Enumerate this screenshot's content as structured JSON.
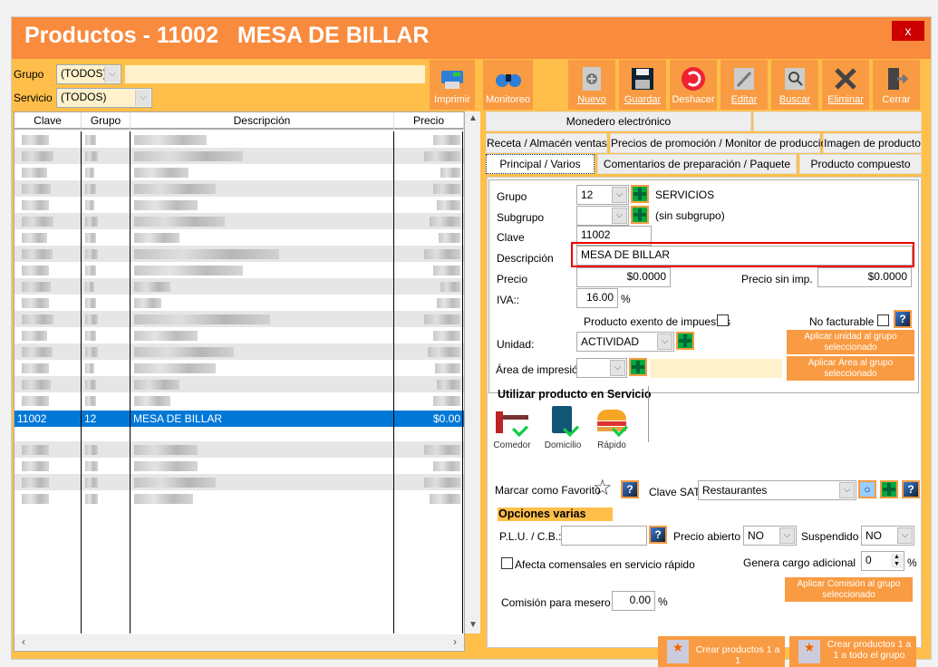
{
  "window": {
    "title": "Productos - 11002   MESA DE BILLAR",
    "close_label": "x"
  },
  "filters": {
    "grupo_label": "Grupo",
    "grupo_value": "(TODOS)",
    "servicio_label": "Servicio",
    "servicio_value": "(TODOS)",
    "search_value": ""
  },
  "toolbar": {
    "imprimir": "Imprimir",
    "monitoreo": "Monitoreo",
    "nuevo": "Nuevo",
    "guardar": "Guardar",
    "deshacer": "Deshacer",
    "editar": "Editar",
    "buscar": "Buscar",
    "eliminar": "Eliminar",
    "cerrar": "Cerrar"
  },
  "grid": {
    "columns": [
      "Clave",
      "Grupo",
      "Descripción",
      "Precio"
    ],
    "selected_row": {
      "clave": "11002",
      "grupo": "12",
      "descripcion": "MESA DE BILLAR",
      "precio": "$0.00"
    }
  },
  "tabs": {
    "row1": [
      "Monedero electrónico",
      ""
    ],
    "row2": [
      "Receta / Almacén ventas",
      "Precios de promoción / Monitor de producción",
      "Imagen de producto"
    ],
    "row3": [
      "Principal / Varios",
      "Comentarios de preparación / Paquete",
      "Producto compuesto"
    ],
    "active": "Principal / Varios"
  },
  "form": {
    "grupo_label": "Grupo",
    "grupo_value": "12",
    "grupo_name": "SERVICIOS",
    "subgrupo_label": "Subgrupo",
    "subgrupo_value": "",
    "subgrupo_name": "(sin subgrupo)",
    "clave_label": "Clave",
    "clave_value": "11002",
    "descripcion_label": "Descripción",
    "descripcion_value": "MESA DE BILLAR",
    "precio_label": "Precio",
    "precio_value": "$0.0000",
    "precio_sin_imp_label": "Precio sin imp.",
    "precio_sin_imp_value": "$0.0000",
    "iva_label": "IVA::",
    "iva_value": "16.00",
    "pct": "%",
    "exento_label": "Producto exento de impuestos",
    "exento_checked": false,
    "no_facturable_label": "No facturable",
    "no_facturable_checked": false,
    "unidad_label": "Unidad:",
    "unidad_value": "ACTIVIDAD",
    "aplicar_unidad": "Aplicar unidad al grupo seleccionado",
    "area_label": "Área de impresión:",
    "area_value": "",
    "aplicar_area": "Aplicar Área al grupo seleccionado",
    "servicio_title": "Utilizar producto en Servicio",
    "servicios": [
      {
        "label": "Comedor",
        "checked": true
      },
      {
        "label": "Domicilio",
        "checked": true
      },
      {
        "label": "Rápido",
        "checked": true
      }
    ],
    "favorito_label": "Marcar como Favorito",
    "clave_sat_label": "Clave SAT",
    "clave_sat_value": "Restaurantes",
    "opciones_title": "Opciones varias",
    "plu_label": "P.L.U. / C.B.:",
    "plu_value": "",
    "precio_abierto_label": "Precio abierto",
    "precio_abierto_value": "NO",
    "suspendido_label": "Suspendido",
    "suspendido_value": "NO",
    "afecta_label": "Afecta comensales en servicio rápido",
    "afecta_checked": false,
    "genera_label": "Genera cargo adicional",
    "genera_value": "0",
    "aplicar_comision": "Aplicar Comisión al grupo seleccionado",
    "comision_label": "Comisión para mesero",
    "comision_value": "0.00",
    "crear_1a1": "Crear productos 1 a 1",
    "crear_grupo": "Crear productos 1 a 1 a todo el grupo"
  },
  "colors": {
    "titlebar": "#F98B3E",
    "toolbar": "#FFBF4A",
    "button": "#F99B42",
    "selection": "#0078D7",
    "highlight_box": "#E00000"
  }
}
